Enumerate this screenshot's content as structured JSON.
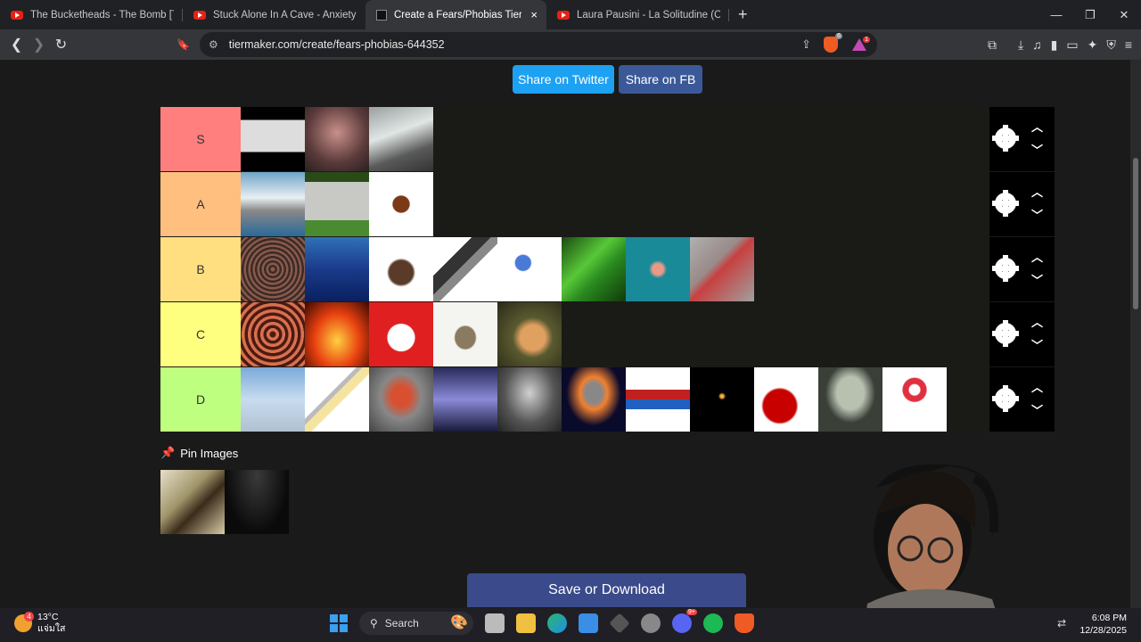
{
  "tabs": [
    {
      "title": "The Bucketheads - The Bomb [These",
      "favicon": "youtube-icon",
      "active": false
    },
    {
      "title": "Stuck Alone In A Cave - Anxiety Warr",
      "favicon": "youtube-icon",
      "active": false
    },
    {
      "title": "Create a Fears/Phobias Tier List",
      "favicon": "tiermaker-icon",
      "active": true,
      "close": "×"
    },
    {
      "title": "Laura Pausini - La Solitudine (Official",
      "favicon": "youtube-icon",
      "active": false
    }
  ],
  "new_tab": "+",
  "window_controls": {
    "minimize": "—",
    "maximize": "❐",
    "close": "✕"
  },
  "nav": {
    "back": "❮",
    "forward": "❯",
    "reload": "↻",
    "bookmark": "🔖"
  },
  "url": "tiermaker.com/create/fears-phobias-644352",
  "extensions": {
    "brave_badge": "6",
    "rewards_badge": "1"
  },
  "share": {
    "twitter": "Share on Twitter",
    "facebook": "Share on FB"
  },
  "tiers": [
    {
      "label": "S",
      "color": "#ff7f7f",
      "items": [
        "window-silhouette",
        "scared-girl",
        "glass-floor"
      ]
    },
    {
      "label": "A",
      "color": "#ffbf7f",
      "items": [
        "shark",
        "gravestone",
        "cockroach"
      ]
    },
    {
      "label": "B",
      "color": "#ffdf7f",
      "items": [
        "crowd",
        "ocean",
        "tarantula",
        "microphone",
        "virus",
        "green-snake",
        "sea-creature",
        "centipede"
      ]
    },
    {
      "label": "C",
      "color": "#ffff7f",
      "items": [
        "holes",
        "fire",
        "clown",
        "mouse",
        "lizard"
      ]
    },
    {
      "label": "D",
      "color": "#bfff7f",
      "items": [
        "airplane",
        "syringe",
        "puppet",
        "lightning",
        "man-portrait",
        "asteroid",
        "knot",
        "dark-candle",
        "blood",
        "alien",
        "red-ring"
      ]
    }
  ],
  "tier_controls": {
    "up": "︿",
    "down": "﹀"
  },
  "pin_images": "Pin Images",
  "pool_items": [
    "scorpion-hand",
    "darkness"
  ],
  "save_button": "Save or Download",
  "taskbar": {
    "weather_temp": "13°C",
    "weather_desc": "แจ่มใส",
    "weather_badge": "4",
    "search": "Search",
    "time": "6:08 PM",
    "date": "12/28/2025",
    "discord_badge": "9+"
  }
}
